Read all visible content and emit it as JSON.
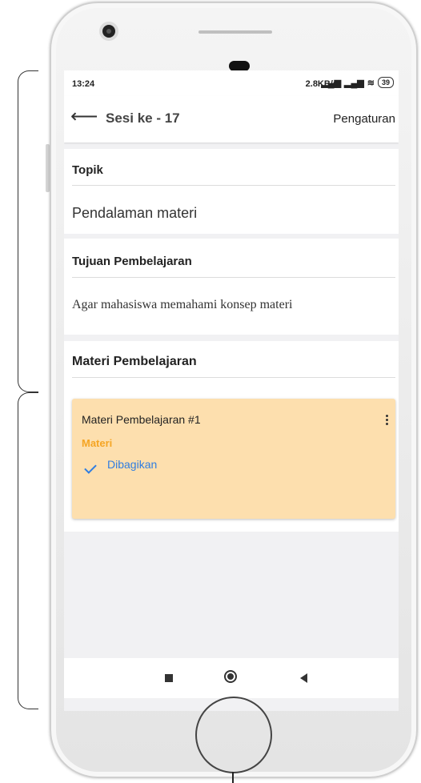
{
  "status_bar": {
    "time": "13:24",
    "network_speed": "2.8KB/s",
    "battery": "39"
  },
  "app_bar": {
    "title": "Sesi ke - 17",
    "settings_label": "Pengaturan"
  },
  "topic": {
    "heading": "Topik",
    "value": "Pendalaman materi"
  },
  "objective": {
    "heading": "Tujuan Pembelajaran",
    "value": "Agar mahasiswa memahami konsep materi"
  },
  "materials": {
    "heading": "Materi Pembelajaran",
    "items": [
      {
        "name": "Materi Pembelajaran #1",
        "type": "Materi",
        "status": "Dibagikan"
      }
    ]
  },
  "colors": {
    "material_card_bg": "#fddfae",
    "material_type": "#f5a524",
    "shared_status": "#2f7de1"
  }
}
